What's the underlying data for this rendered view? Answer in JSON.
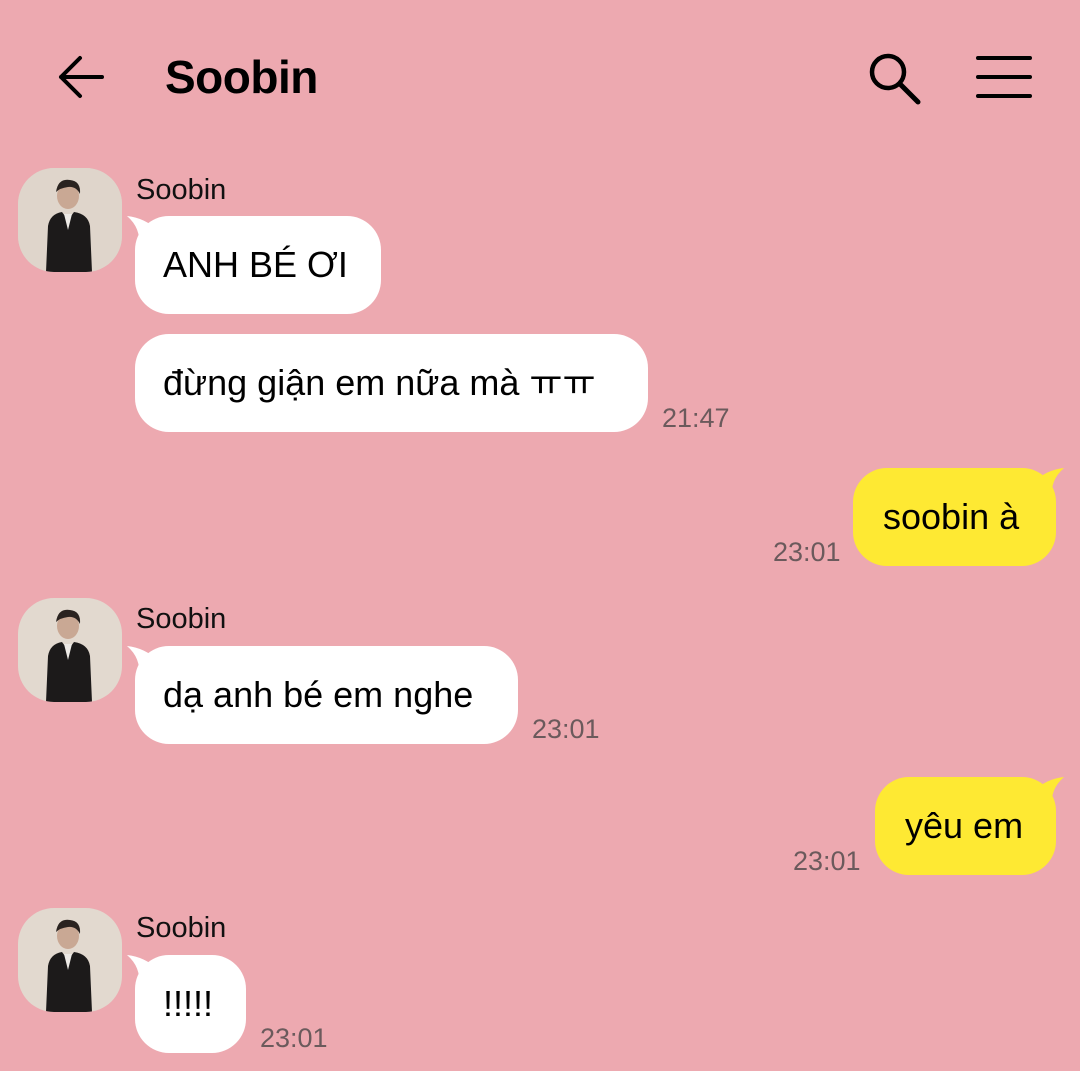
{
  "header": {
    "title": "Soobin",
    "back_icon": "arrow-left-icon",
    "search_icon": "search-icon",
    "menu_icon": "hamburger-menu-icon"
  },
  "colors": {
    "background": "#EDA9B0",
    "incoming_bubble": "#FFFFFF",
    "outgoing_bubble": "#FEE933",
    "timestamp": "#6b5a5c"
  },
  "messages": [
    {
      "sender": "Soobin",
      "text": "ANH BÉ ƠI"
    },
    {
      "text": "đừng giận em nữa mà ㅠㅠ",
      "time": "21:47"
    },
    {
      "text": "soobin à",
      "time": "23:01"
    },
    {
      "sender": "Soobin",
      "text": "dạ anh bé em nghe",
      "time": "23:01"
    },
    {
      "text": "yêu em",
      "time": "23:01"
    },
    {
      "sender": "Soobin",
      "text": "!!!!!",
      "time": "23:01"
    }
  ]
}
